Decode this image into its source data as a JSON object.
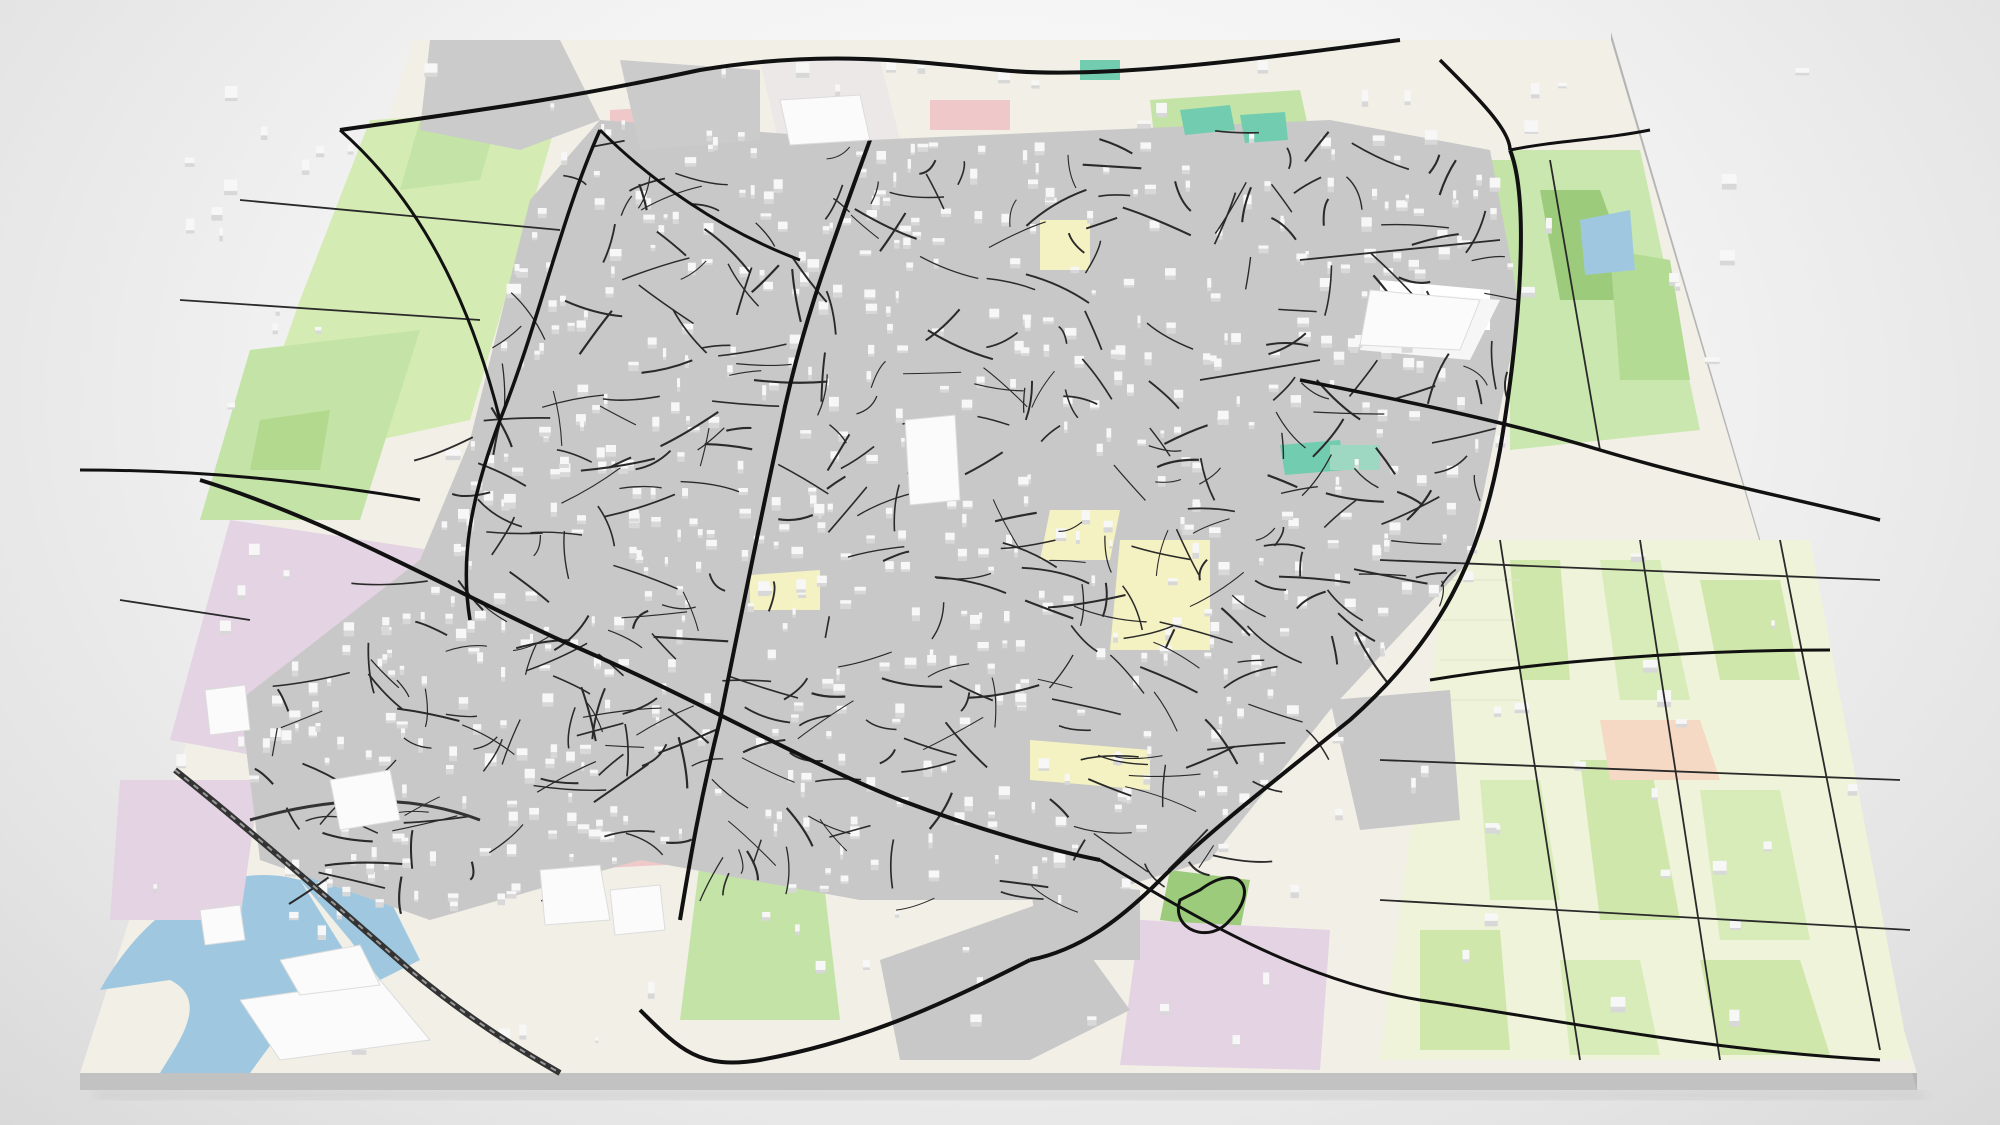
{
  "scene": {
    "subject": "3D map model",
    "background_color": "#efefef"
  },
  "colors": {
    "base_land": "#f1efe6",
    "base_side": "#c9c9c9",
    "urban_fill": "#c8c8c8",
    "building": "#f7f7f7",
    "building_shade": "#d8d8d8",
    "park": "#c4e3a6",
    "park_dark": "#9ccc7b",
    "farmland": "#e9f1d2",
    "meadow": "#d7ecb8",
    "water": "#9fc8e0",
    "industrial": "#e3d3e3",
    "commercial": "#efc9c9",
    "sports": "#72cdb0",
    "road_major": "#111111",
    "road_minor": "#2a2a2a",
    "railway": "#333333"
  },
  "layers": [
    {
      "name": "land",
      "visible": true
    },
    {
      "name": "farmland",
      "visible": true
    },
    {
      "name": "parks",
      "visible": true
    },
    {
      "name": "water",
      "visible": true
    },
    {
      "name": "industrial",
      "visible": true
    },
    {
      "name": "commercial",
      "visible": true
    },
    {
      "name": "residential",
      "visible": true
    },
    {
      "name": "buildings",
      "visible": true
    },
    {
      "name": "roads",
      "visible": true
    },
    {
      "name": "railway",
      "visible": true
    }
  ],
  "text": {}
}
